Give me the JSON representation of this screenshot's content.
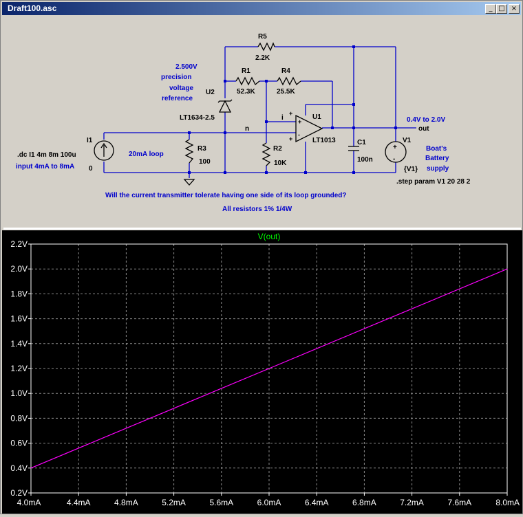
{
  "window": {
    "title": "Draft100.asc",
    "minimize": "_",
    "maximize": "□",
    "close": "×"
  },
  "schematic": {
    "wire_color": "#0000cc",
    "component_color": "#000000",
    "comment_color": "#0000cc",
    "components": {
      "R5": {
        "ref": "R5",
        "value": "2.2K"
      },
      "R1": {
        "ref": "R1",
        "value": "52.3K"
      },
      "R4": {
        "ref": "R4",
        "value": "25.5K"
      },
      "R3": {
        "ref": "R3",
        "value": "100"
      },
      "R2": {
        "ref": "R2",
        "value": "10K"
      },
      "C1": {
        "ref": "C1",
        "value": "100n"
      },
      "U1": {
        "ref": "U1",
        "value": "LT1013"
      },
      "U2": {
        "ref": "U2",
        "value": "LT1634-2.5"
      },
      "I1": {
        "ref": "I1",
        "value": "0"
      },
      "V1": {
        "ref": "V1",
        "value": "{V1}"
      }
    },
    "nets": {
      "n": "n",
      "i": "i",
      "out": "out"
    },
    "comments": {
      "ref_line1": "2.500V",
      "ref_line2": "precision",
      "ref_line3": "voltage",
      "ref_line4": "reference",
      "loop": "20mA loop",
      "input": "input 4mA to 8mA",
      "out_range": "0.4V to 2.0V",
      "batt1": "Boat's",
      "batt2": "Battery",
      "batt3": "supply",
      "question": "Will the current transmitter tolerate having one side of its loop grounded?",
      "resistors": "All resistors 1% 1/4W"
    },
    "directives": {
      "dc": ".dc I1 4m 8m 100u",
      "step": ".step param V1 20 28 2"
    }
  },
  "plot": {
    "background": "#000000",
    "grid_color": "#8c8c8c",
    "axis_color": "#ffffff",
    "trace_color": "#ff00ff",
    "title_color": "#00ff00"
  },
  "chart_data": {
    "type": "line",
    "title": "V(out)",
    "xlabel": "",
    "ylabel": "",
    "xlim": [
      4.0,
      8.0
    ],
    "ylim": [
      0.2,
      2.2
    ],
    "x_ticks": [
      "4.0mA",
      "4.4mA",
      "4.8mA",
      "5.2mA",
      "5.6mA",
      "6.0mA",
      "6.4mA",
      "6.8mA",
      "7.2mA",
      "7.6mA",
      "8.0mA"
    ],
    "y_ticks": [
      "0.2V",
      "0.4V",
      "0.6V",
      "0.8V",
      "1.0V",
      "1.2V",
      "1.4V",
      "1.6V",
      "1.8V",
      "2.0V",
      "2.2V"
    ],
    "grid": true,
    "series": [
      {
        "name": "V(out)",
        "x": [
          4.0,
          5.0,
          6.0,
          7.0,
          8.0
        ],
        "y": [
          0.4,
          0.8,
          1.2,
          1.6,
          2.0
        ]
      }
    ]
  }
}
